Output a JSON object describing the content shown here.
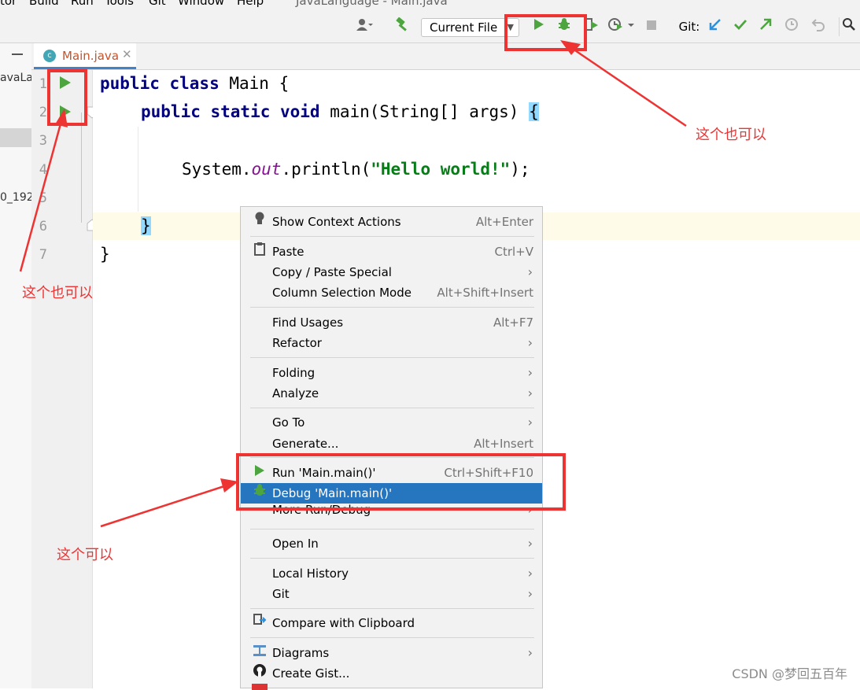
{
  "menubar": {
    "items": [
      "tor",
      "Build",
      "Run",
      "Tools",
      "Git",
      "Window",
      "Help"
    ],
    "title_text": "JavaLanguage - Main.java"
  },
  "toolbar": {
    "run_config": "Current File",
    "git_label": "Git:"
  },
  "project": {
    "partial_name": "avaLar",
    "partial_file": "0_192"
  },
  "tab": {
    "label": "Main.java"
  },
  "gutter": {
    "line_numbers": [
      "1",
      "2",
      "3",
      "4",
      "5",
      "6",
      "7"
    ]
  },
  "code": {
    "line1_kw": "public class",
    "line1_name": " Main {",
    "line2_kw": "public static void",
    "line2_rest": " main(String[] args) ",
    "line2_brace": "{",
    "line4_a": "System.",
    "line4_field": "out",
    "line4_b": ".println(",
    "line4_str": "\"Hello world!\"",
    "line4_c": ");",
    "line6_brace": "}",
    "line7_brace": "}"
  },
  "context_menu": {
    "show_context_actions": {
      "label": "Show Context Actions",
      "shortcut": "Alt+Enter"
    },
    "paste": {
      "label": "Paste",
      "shortcut": "Ctrl+V"
    },
    "copy_paste_special": {
      "label": "Copy / Paste Special"
    },
    "column_selection_mode": {
      "label": "Column Selection Mode",
      "shortcut": "Alt+Shift+Insert"
    },
    "find_usages": {
      "label": "Find Usages",
      "shortcut": "Alt+F7"
    },
    "refactor": {
      "label": "Refactor"
    },
    "folding": {
      "label": "Folding"
    },
    "analyze": {
      "label": "Analyze"
    },
    "go_to": {
      "label": "Go To"
    },
    "generate": {
      "label": "Generate...",
      "shortcut": "Alt+Insert"
    },
    "run": {
      "label": "Run 'Main.main()'",
      "shortcut": "Ctrl+Shift+F10"
    },
    "debug": {
      "label": "Debug 'Main.main()'"
    },
    "more_run_debug": {
      "label": "More Run/Debug"
    },
    "open_in": {
      "label": "Open In"
    },
    "local_history": {
      "label": "Local History"
    },
    "git": {
      "label": "Git"
    },
    "compare_clipboard": {
      "label": "Compare with Clipboard"
    },
    "diagrams": {
      "label": "Diagrams"
    },
    "create_gist": {
      "label": "Create Gist..."
    }
  },
  "annotations": {
    "note_top_right": "这个也可以",
    "note_left": "这个也可以",
    "note_bottom": "这个可以"
  },
  "watermark": "CSDN @梦回五百年",
  "colors": {
    "annotation_red": "#ee3333",
    "selection_blue": "#2675bf",
    "run_green": "#4da53f",
    "keyword_navy": "#000080",
    "string_green": "#067d17",
    "field_purple": "#871094"
  },
  "icons": [
    "user-icon",
    "hammer-icon",
    "run-icon",
    "debug-icon",
    "coverage-icon",
    "profile-icon",
    "stop-icon",
    "git-update-icon",
    "git-commit-icon",
    "git-push-icon",
    "history-icon",
    "rollback-icon",
    "search-icon",
    "bulb-icon",
    "clipboard-icon",
    "compare-icon",
    "diagram-icon",
    "github-icon"
  ]
}
